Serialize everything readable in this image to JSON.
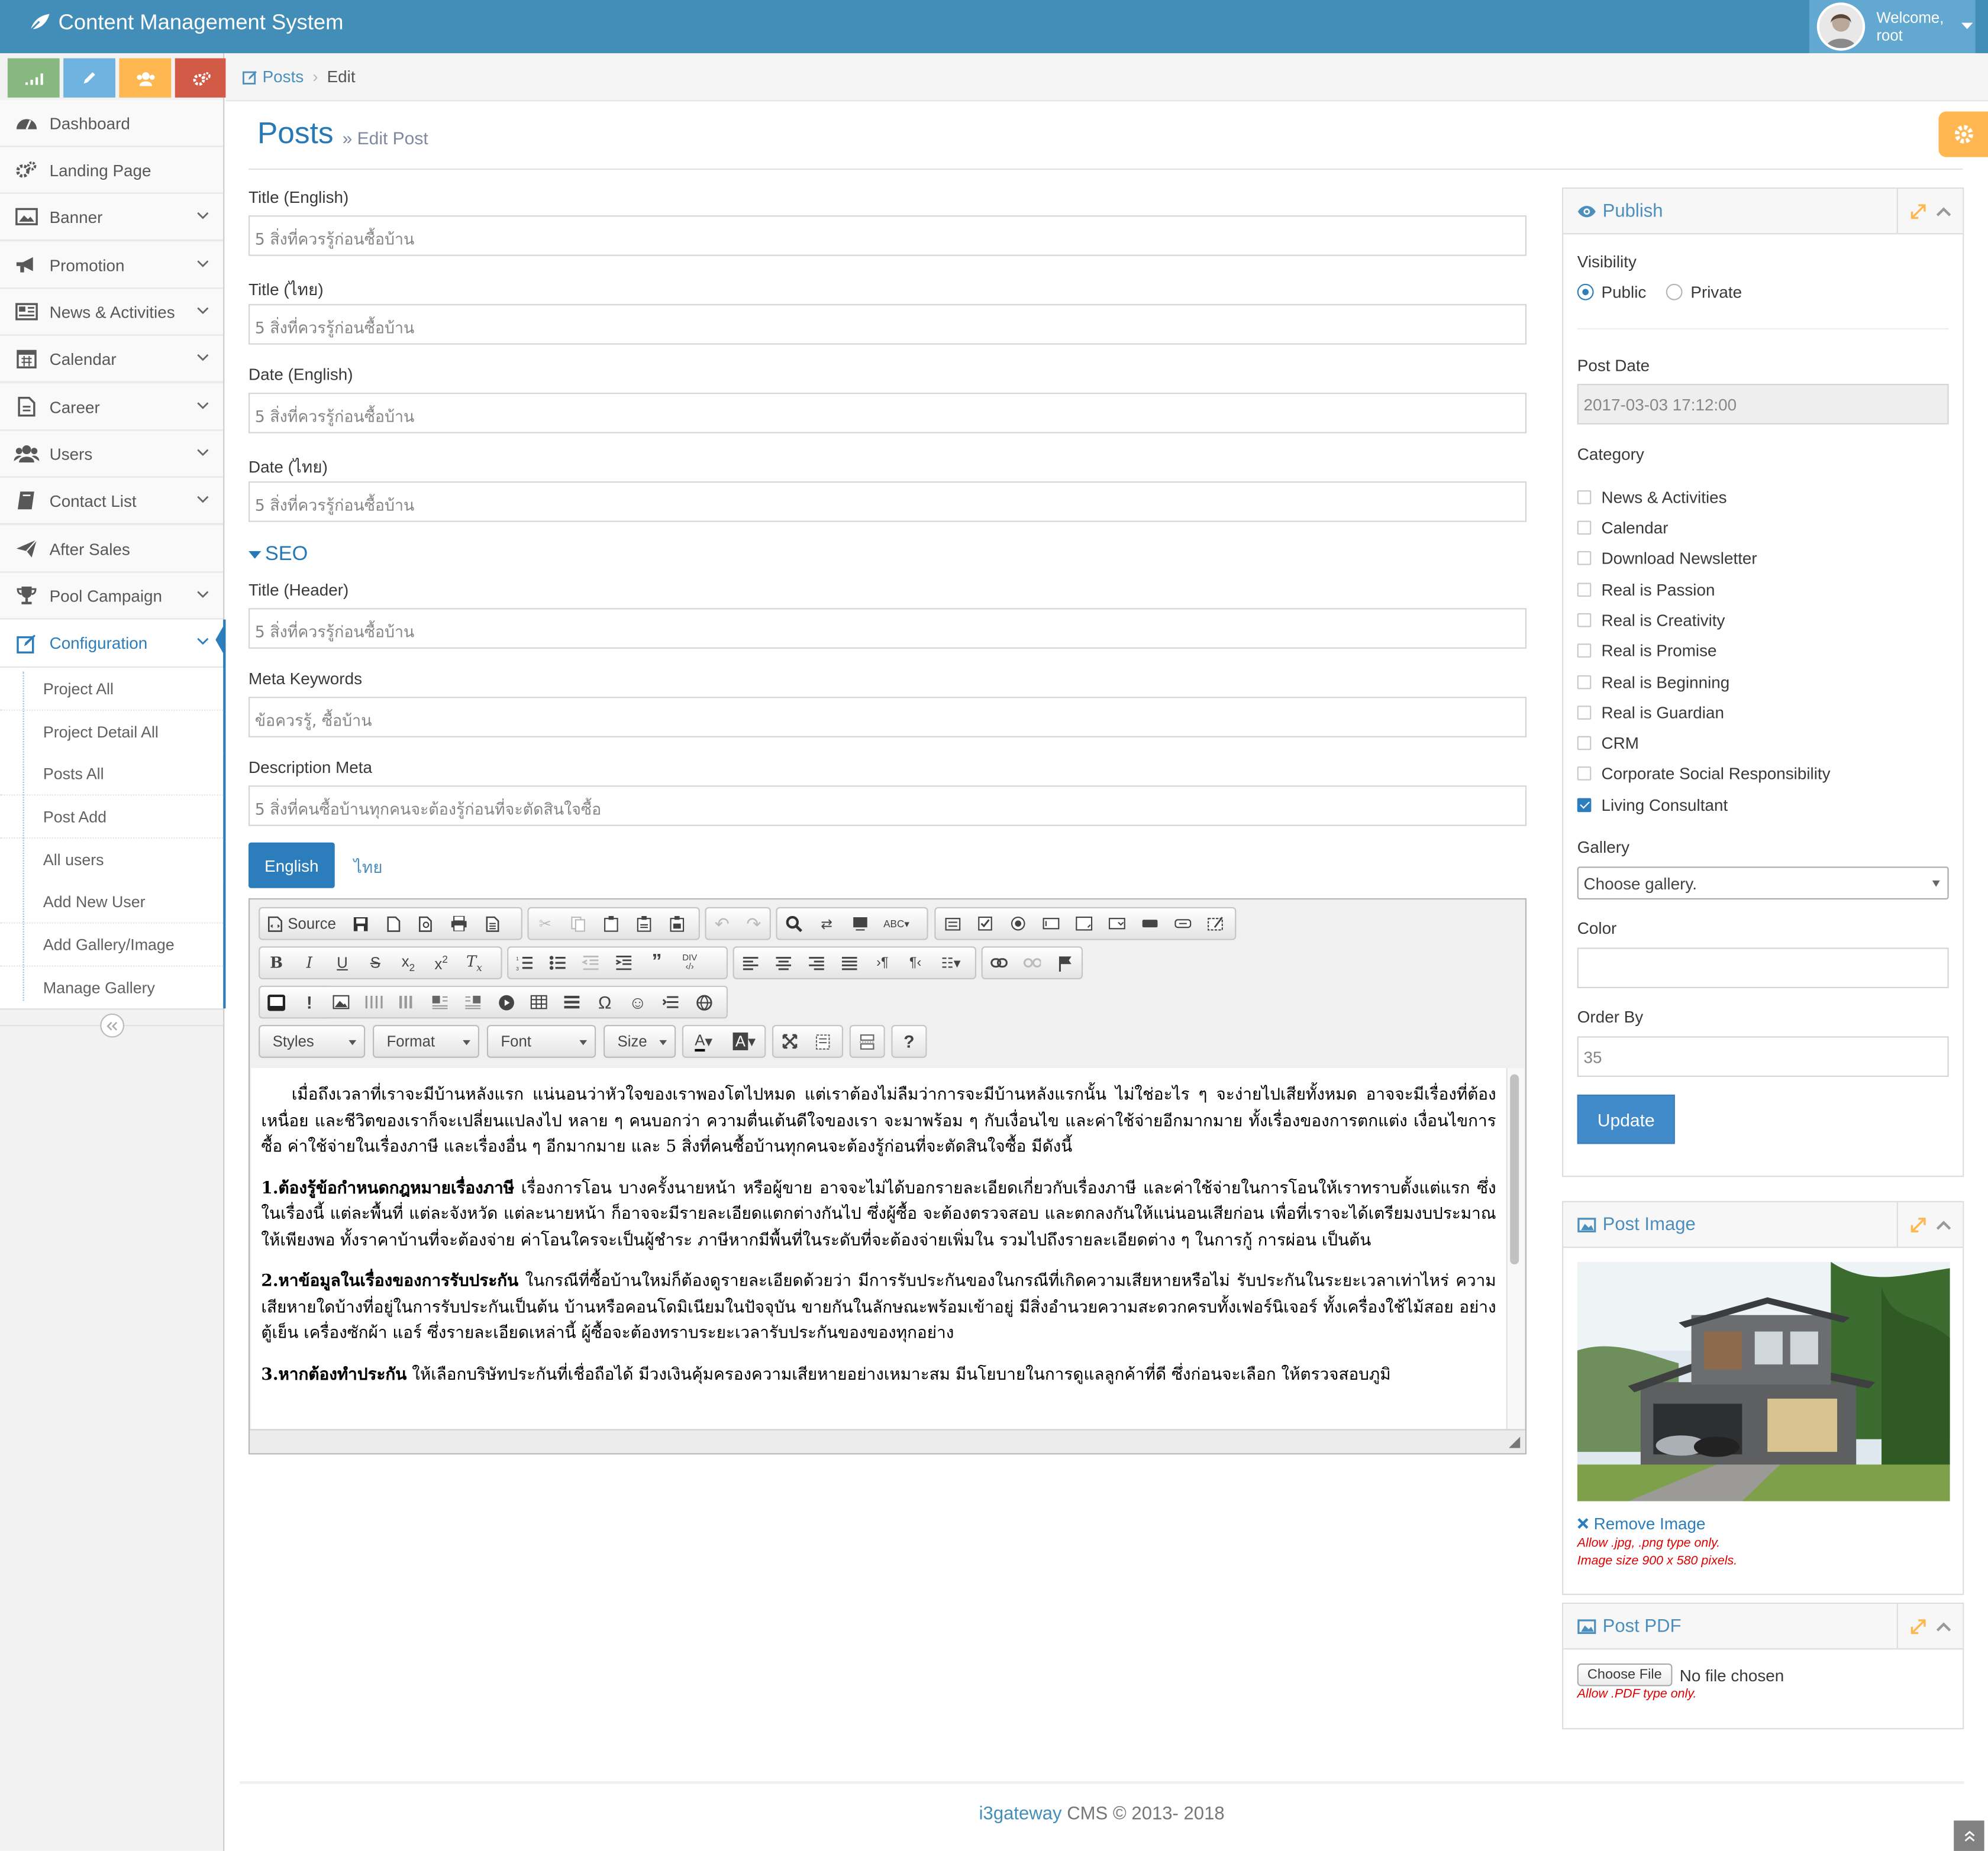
{
  "app": {
    "title": "Content Management System"
  },
  "user": {
    "welcome": "Welcome,",
    "name": "root"
  },
  "sidebar": {
    "items": [
      {
        "label": "Dashboard"
      },
      {
        "label": "Landing Page"
      },
      {
        "label": "Banner"
      },
      {
        "label": "Promotion"
      },
      {
        "label": "News & Activities"
      },
      {
        "label": "Calendar"
      },
      {
        "label": "Career"
      },
      {
        "label": "Users"
      },
      {
        "label": "Contact List"
      },
      {
        "label": "After Sales"
      },
      {
        "label": "Pool Campaign"
      },
      {
        "label": "Configuration"
      }
    ],
    "submenu": [
      "Project All",
      "Project Detail All",
      "Posts All",
      "Post Add",
      "All users",
      "Add New User",
      "Add Gallery/Image",
      "Manage Gallery"
    ],
    "shortcut_colors": [
      "#87b87f",
      "#6fb3e0",
      "#ffb752",
      "#d15b47"
    ]
  },
  "breadcrumb": {
    "root": "Posts",
    "current": "Edit"
  },
  "page": {
    "title": "Posts",
    "subtitle": "Edit Post"
  },
  "form": {
    "title_en_label": "Title (English)",
    "title_en_value": "5 สิ่งที่ควรรู้ก่อนซื้อบ้าน",
    "title_th_label": "Title (ไทย)",
    "title_th_value": "5 สิ่งที่ควรรู้ก่อนซื้อบ้าน",
    "date_en_label": "Date (English)",
    "date_en_value": "5 สิ่งที่ควรรู้ก่อนซื้อบ้าน",
    "date_th_label": "Date (ไทย)",
    "date_th_value": "5 สิ่งที่ควรรู้ก่อนซื้อบ้าน",
    "seo_heading": "SEO",
    "seo_title_label": "Title (Header)",
    "seo_title_value": "5 สิ่งที่ควรรู้ก่อนซื้อบ้าน",
    "meta_keywords_label": "Meta Keywords",
    "meta_keywords_value": "ข้อควรรู้, ซื้อบ้าน",
    "desc_meta_label": "Description Meta",
    "desc_meta_value": "5 สิ่งที่คนซื้อบ้านทุกคนจะต้องรู้ก่อนที่จะตัดสินใจซื้อ",
    "lang_tabs": [
      "English",
      "ไทย"
    ]
  },
  "editor": {
    "source_label": "Source",
    "combos": [
      "Styles",
      "Format",
      "Font",
      "Size"
    ],
    "content": [
      {
        "lead": "",
        "text": "เมื่อถึงเวลาที่เราจะมีบ้านหลังแรก แน่นอนว่าหัวใจของเราพองโตไปหมด แต่เราต้องไม่ลืมว่าการจะมีบ้านหลังแรกนั้น ไม่ใช่อะไร ๆ จะง่ายไปเสียทั้งหมด อาจจะมีเรื่องที่ต้องเหนื่อย และชีวิตของเราก็จะเปลี่ยนแปลงไป หลาย ๆ คนบอกว่า ความตื่นเต้นดีใจของเรา จะมาพร้อม ๆ กับเงื่อนไข และค่าใช้จ่ายอีกมากมาย ทั้งเรื่องของการตกแต่ง เงื่อนไขการซื้อ ค่าใช้จ่ายในเรื่องภาษี และเรื่องอื่น ๆ อีกมากมาย และ 5 สิ่งที่คนซื้อบ้านทุกคนจะต้องรู้ก่อนที่จะตัดสินใจซื้อ มีดังนี้"
      },
      {
        "lead": "1.ต้องรู้ข้อกำหนดกฎหมายเรื่องภาษี",
        "text": " เรื่องการโอน บางครั้งนายหน้า หรือผู้ขาย อาจจะไม่ได้บอกรายละเอียดเกี่ยวกับเรื่องภาษี และค่าใช้จ่ายในการโอนให้เราทราบตั้งแต่แรก ซึ่งในเรื่องนี้ แต่ละพื้นที่ แต่ละจังหวัด แต่ละนายหน้า ก็อาจจะมีรายละเอียดแตกต่างกันไป ซึ่งผู้ซื้อ จะต้องตรวจสอบ และตกลงกันให้แน่นอนเสียก่อน เพื่อที่เราจะได้เตรียมงบประมาณให้เพียงพอ ทั้งราคาบ้านที่จะต้องจ่าย ค่าโอนใครจะเป็นผู้ชำระ ภาษีหากมีพื้นที่ในระดับที่จะต้องจ่ายเพิ่มใน รวมไปถึงรายละเอียดต่าง ๆ ในการกู้ การผ่อน เป็นต้น"
      },
      {
        "lead": "2.หาข้อมูลในเรื่องของการรับประกัน",
        "text": " ในกรณีที่ซื้อบ้านใหม่ก็ต้องดูรายละเอียดด้วยว่า มีการรับประกันของในกรณีที่เกิดความเสียหายหรือไม่ รับประกันในระยะเวลาเท่าไหร่ ความเสียหายใดบ้างที่อยู่ในการรับประกันเป็นต้น บ้านหรือคอนโดมิเนียมในปัจจุบัน ขายกันในลักษณะพร้อมเข้าอยู่ มีสิ่งอำนวยความสะดวกครบทั้งเฟอร์นิเจอร์ ทั้งเครื่องใช้ไม้สอย อย่างตู้เย็น เครื่องซักผ้า แอร์ ซึ่งรายละเอียดเหล่านี้ ผู้ซื้อจะต้องทราบระยะเวลารับประกันของของทุกอย่าง"
      },
      {
        "lead": "3.หากต้องทำประกัน",
        "text": " ให้เลือกบริษัทประกันที่เชื่อถือได้ มีวงเงินคุ้มครองความเสียหายอย่างเหมาะสม มีนโยบายในการดูแลลูกค้าที่ดี ซึ่งก่อนจะเลือก ให้ตรวจสอบภูมิ"
      }
    ]
  },
  "publish": {
    "title": "Publish",
    "visibility_label": "Visibility",
    "visibility_options": [
      "Public",
      "Private"
    ],
    "visibility_selected": "Public",
    "post_date_label": "Post Date",
    "post_date_value": "2017-03-03 17:12:00",
    "category_label": "Category",
    "categories": [
      {
        "label": "News & Activities",
        "checked": false
      },
      {
        "label": "Calendar",
        "checked": false
      },
      {
        "label": "Download Newsletter",
        "checked": false
      },
      {
        "label": "Real is Passion",
        "checked": false
      },
      {
        "label": "Real is Creativity",
        "checked": false
      },
      {
        "label": "Real is Promise",
        "checked": false
      },
      {
        "label": "Real is Beginning",
        "checked": false
      },
      {
        "label": "Real is Guardian",
        "checked": false
      },
      {
        "label": "CRM",
        "checked": false
      },
      {
        "label": "Corporate Social Responsibility",
        "checked": false
      },
      {
        "label": "Living Consultant",
        "checked": true
      }
    ],
    "gallery_label": "Gallery",
    "gallery_value": "Choose gallery.",
    "color_label": "Color",
    "color_value": "",
    "order_label": "Order By",
    "order_value": "35",
    "update_label": "Update"
  },
  "post_image": {
    "title": "Post Image",
    "remove_label": "Remove Image",
    "note1": "Allow .jpg, .png type only.",
    "note2": "Image size 900 x 580 pixels."
  },
  "post_pdf": {
    "title": "Post PDF",
    "choose_label": "Choose File",
    "no_file": "No file chosen",
    "note": "Allow .PDF type only."
  },
  "footer": {
    "brand": "i3gateway",
    "text": " CMS © 2013- 2018"
  },
  "colors": {
    "navbar": "#438eb9",
    "accent": "#2b7dbc",
    "settings": "#ffb752"
  }
}
